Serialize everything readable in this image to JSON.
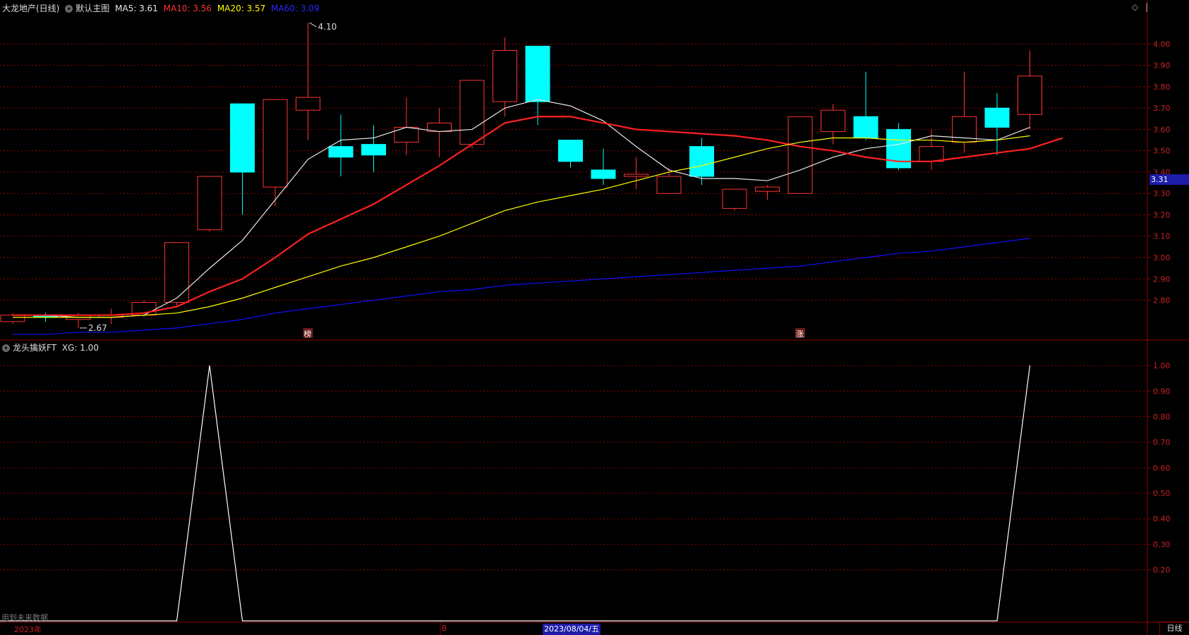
{
  "main_legend": {
    "stock": "大龙地产(日线)",
    "template": "默认主图",
    "ma5": "MA5: 3.61",
    "ma10": "MA10: 3.56",
    "ma20": "MA20: 3.57",
    "ma60": "MA60: 3.09"
  },
  "sub_legend": {
    "indicator": "龙头擒妖FT",
    "xg": "XG: 1.00"
  },
  "last_price_tag": "3.31",
  "high_marker": "4.10",
  "low_marker": "2.67",
  "signal_marks": [
    "榜",
    "涨"
  ],
  "bottom_axis": {
    "year_label": "2023年",
    "month_label": "8",
    "current_date": "2023/08/04/五",
    "period": "日线"
  },
  "future_data_note": "用到未来数据",
  "colors": {
    "up": "#ff3333",
    "down": "#00ffff",
    "ma5": "#e8e8e8",
    "ma10": "#ff2020",
    "ma20": "#ffff00",
    "ma60": "#1010ff",
    "grid": "#8b0000",
    "indicator": "#ffffff",
    "axis_text": "#cc2222"
  },
  "chart_data": [
    {
      "type": "candlestick",
      "title": "大龙地产(日线)",
      "ylim": [
        2.62,
        4.14
      ],
      "y_ticks": [
        2.8,
        2.9,
        3.0,
        3.1,
        3.2,
        3.3,
        3.4,
        3.5,
        3.6,
        3.7,
        3.8,
        3.9,
        4.0
      ],
      "candles": [
        {
          "o": 2.7,
          "h": 2.74,
          "l": 2.69,
          "c": 2.73
        },
        {
          "o": 2.73,
          "h": 2.74,
          "l": 2.7,
          "c": 2.72
        },
        {
          "o": 2.71,
          "h": 2.74,
          "l": 2.67,
          "c": 2.73
        },
        {
          "o": 2.72,
          "h": 2.76,
          "l": 2.69,
          "c": 2.73
        },
        {
          "o": 2.73,
          "h": 2.8,
          "l": 2.72,
          "c": 2.79
        },
        {
          "o": 2.79,
          "h": 3.07,
          "l": 2.77,
          "c": 3.07
        },
        {
          "o": 3.13,
          "h": 3.38,
          "l": 3.12,
          "c": 3.38
        },
        {
          "o": 3.72,
          "h": 3.72,
          "l": 3.2,
          "c": 3.4
        },
        {
          "o": 3.33,
          "h": 3.74,
          "l": 3.24,
          "c": 3.74
        },
        {
          "o": 3.69,
          "h": 4.1,
          "l": 3.55,
          "c": 3.75
        },
        {
          "o": 3.52,
          "h": 3.67,
          "l": 3.38,
          "c": 3.47
        },
        {
          "o": 3.53,
          "h": 3.62,
          "l": 3.4,
          "c": 3.48
        },
        {
          "o": 3.54,
          "h": 3.75,
          "l": 3.48,
          "c": 3.61
        },
        {
          "o": 3.59,
          "h": 3.7,
          "l": 3.47,
          "c": 3.63
        },
        {
          "o": 3.53,
          "h": 3.83,
          "l": 3.51,
          "c": 3.83
        },
        {
          "o": 3.73,
          "h": 4.03,
          "l": 3.66,
          "c": 3.97
        },
        {
          "o": 3.99,
          "h": 3.99,
          "l": 3.62,
          "c": 3.73
        },
        {
          "o": 3.55,
          "h": 3.55,
          "l": 3.42,
          "c": 3.45
        },
        {
          "o": 3.41,
          "h": 3.51,
          "l": 3.34,
          "c": 3.37
        },
        {
          "o": 3.38,
          "h": 3.47,
          "l": 3.32,
          "c": 3.39
        },
        {
          "o": 3.3,
          "h": 3.42,
          "l": 3.3,
          "c": 3.38
        },
        {
          "o": 3.52,
          "h": 3.56,
          "l": 3.34,
          "c": 3.38
        },
        {
          "o": 3.23,
          "h": 3.32,
          "l": 3.22,
          "c": 3.32
        },
        {
          "o": 3.31,
          "h": 3.34,
          "l": 3.27,
          "c": 3.33
        },
        {
          "o": 3.3,
          "h": 3.66,
          "l": 3.3,
          "c": 3.66
        },
        {
          "o": 3.59,
          "h": 3.72,
          "l": 3.53,
          "c": 3.69
        },
        {
          "o": 3.66,
          "h": 3.87,
          "l": 3.55,
          "c": 3.56
        },
        {
          "o": 3.6,
          "h": 3.63,
          "l": 3.41,
          "c": 3.42
        },
        {
          "o": 3.45,
          "h": 3.6,
          "l": 3.41,
          "c": 3.52
        },
        {
          "o": 3.54,
          "h": 3.87,
          "l": 3.49,
          "c": 3.66
        },
        {
          "o": 3.7,
          "h": 3.77,
          "l": 3.48,
          "c": 3.61
        },
        {
          "o": 3.67,
          "h": 3.97,
          "l": 3.6,
          "c": 3.85
        }
      ],
      "series": [
        {
          "name": "MA5",
          "values": [
            2.73,
            2.73,
            2.72,
            2.72,
            2.73,
            2.81,
            2.95,
            3.08,
            3.27,
            3.46,
            3.55,
            3.56,
            3.61,
            3.59,
            3.6,
            3.7,
            3.74,
            3.71,
            3.64,
            3.52,
            3.41,
            3.37,
            3.37,
            3.36,
            3.41,
            3.47,
            3.51,
            3.53,
            3.57,
            3.56,
            3.55,
            3.61
          ]
        },
        {
          "name": "MA10",
          "values": [
            2.73,
            2.73,
            2.73,
            2.73,
            2.74,
            2.77,
            2.84,
            2.9,
            3.0,
            3.11,
            3.18,
            3.25,
            3.34,
            3.43,
            3.53,
            3.63,
            3.66,
            3.66,
            3.63,
            3.6,
            3.59,
            3.58,
            3.57,
            3.55,
            3.52,
            3.5,
            3.47,
            3.45,
            3.45,
            3.47,
            3.49,
            3.51,
            3.56
          ]
        },
        {
          "name": "MA20",
          "values": [
            2.72,
            2.72,
            2.72,
            2.72,
            2.73,
            2.74,
            2.77,
            2.81,
            2.86,
            2.91,
            2.96,
            3.0,
            3.05,
            3.1,
            3.16,
            3.22,
            3.26,
            3.29,
            3.32,
            3.36,
            3.4,
            3.43,
            3.47,
            3.51,
            3.54,
            3.56,
            3.56,
            3.55,
            3.55,
            3.54,
            3.55,
            3.57
          ]
        },
        {
          "name": "MA60",
          "values": [
            2.64,
            2.64,
            2.65,
            2.65,
            2.66,
            2.67,
            2.69,
            2.71,
            2.74,
            2.76,
            2.78,
            2.8,
            2.82,
            2.84,
            2.85,
            2.87,
            2.88,
            2.89,
            2.9,
            2.91,
            2.92,
            2.93,
            2.94,
            2.95,
            2.96,
            2.98,
            3.0,
            3.02,
            3.03,
            3.05,
            3.07,
            3.09
          ]
        }
      ],
      "grid": true
    },
    {
      "type": "line",
      "title": "龙头擒妖FT",
      "ylim": [
        0,
        1.05
      ],
      "y_ticks": [
        0.2,
        0.3,
        0.4,
        0.5,
        0.6,
        0.7,
        0.8,
        0.9,
        1.0
      ],
      "series": [
        {
          "name": "XG",
          "values": [
            0,
            0,
            0,
            0,
            0,
            0,
            1,
            0,
            0,
            0,
            0,
            0,
            0,
            0,
            0,
            0,
            0,
            0,
            0,
            0,
            0,
            0,
            0,
            0,
            0,
            0,
            0,
            0,
            0,
            0,
            0,
            1
          ]
        }
      ],
      "grid": true
    }
  ]
}
